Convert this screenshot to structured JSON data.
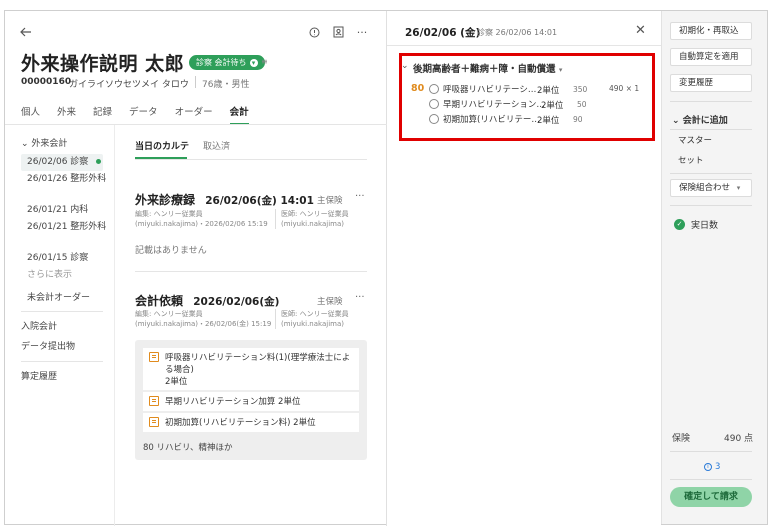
{
  "header": {
    "back_icon": "arrow-left-icon",
    "info_icon": "info-icon",
    "person_icon": "person-card-icon",
    "more_label": "···"
  },
  "patient": {
    "name": "外来操作説明 太郎",
    "status": "診察 会計待ち",
    "id": "00000160",
    "kana": "ガイライソウセツメイ タロウ",
    "age_sex": "76歳・男性"
  },
  "tabs": [
    {
      "label": "個人"
    },
    {
      "label": "外来"
    },
    {
      "label": "記録"
    },
    {
      "label": "データ"
    },
    {
      "label": "オーダー"
    },
    {
      "label": "会計",
      "active": true
    }
  ],
  "nav": {
    "group_label": "外来会計",
    "items": [
      {
        "label": "26/02/06 診察",
        "selected": true
      },
      {
        "label": "26/01/26 整形外科"
      },
      {
        "label": "26/01/21 内科"
      },
      {
        "label": "26/01/21 整形外科"
      },
      {
        "label": "26/01/15 診察"
      }
    ],
    "show_more": "さらに表示",
    "unbilled_orders": "未会計オーダー",
    "inpatient_billing": "入院会計",
    "data_submission": "データ提出物",
    "calculation_history": "算定履歴"
  },
  "content": {
    "subtabs": [
      {
        "label": "当日のカルテ",
        "active": true
      },
      {
        "label": "取込済"
      }
    ],
    "record_card": {
      "title": "外来診療録",
      "datetime": "26/02/06(金) 14:01",
      "insurance": "主保険",
      "editor_line1": "編集: ヘンリー従業員",
      "editor_line2": "(miyuki.nakajima)・2026/02/06 15:19",
      "doctor_line1": "医師: ヘンリー従業員",
      "doctor_line2": "(miyuki.nakajima)",
      "empty_text": "記載はありません"
    },
    "billing_card": {
      "title": "会計依頼",
      "date": "2026/02/06(金)",
      "insurance": "主保険",
      "editor_line1": "編集: ヘンリー従業員",
      "editor_line2": "(miyuki.nakajima)・26/02/06(金) 15:19",
      "doctor_line1": "医師: ヘンリー従業員",
      "doctor_line2": "(miyuki.nakajima)",
      "orders": [
        {
          "line1": "呼吸器リハビリテーション料(1)(理学療法士による場合)",
          "line2": "2単位"
        },
        {
          "line1": "早期リハビリテーション加算 2単位"
        },
        {
          "line1": "初期加算(リハビリテーション料) 2単位"
        }
      ],
      "footer": "80 リハビリ、精神ほか"
    }
  },
  "karte": {
    "date": "26/02/06 (金)",
    "subtitle": "診察 26/02/06 14:01",
    "close_icon": "close-icon",
    "group_title": "後期高齢者＋難病＋障・自動償還",
    "item_code": "80",
    "items": [
      {
        "name": "呼吸器リハビリテーシ…",
        "units": "2単位",
        "points": "350",
        "total": "490 × 1"
      },
      {
        "name": "早期リハビリテーション…",
        "units": "2単位",
        "points": "50"
      },
      {
        "name": "初期加算(リハビリテー…",
        "units": "2単位",
        "points": "90"
      }
    ]
  },
  "actions": {
    "buttons_top": [
      "初期化・再取込",
      "自動算定を適用",
      "変更履歴"
    ],
    "add_header": "会計に追加",
    "buttons_add": [
      "マスター",
      "セット"
    ],
    "insurance_combo": "保険組合わせ",
    "actual_days": "実日数",
    "insurance_label": "保険",
    "insurance_points": "490 点",
    "alert_count": "3",
    "confirm_label": "確定して請求"
  },
  "colors": {
    "accent_green": "#2e9f5a",
    "highlight_red": "#e00000",
    "orange": "#e08b1e",
    "link_blue": "#2b7bd8"
  }
}
